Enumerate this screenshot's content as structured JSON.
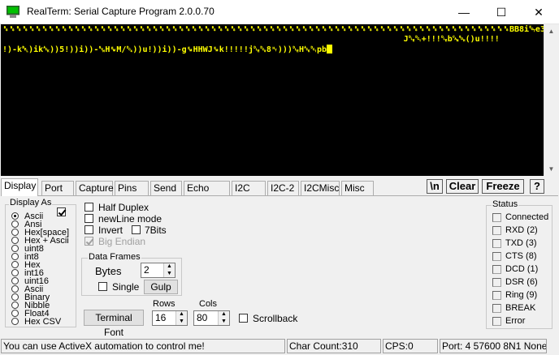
{
  "window": {
    "title": "RealTerm: Serial Capture Program 2.0.0.70",
    "minimize_glyph": "—",
    "maximize_glyph": "☐",
    "close_glyph": "✕",
    "icon": "terminal-app-icon"
  },
  "terminal": {
    "lines": [
      "␈␈␈␈␈␈␈␈␈␈␈␈␈␈␈␈␈␈␈␈␈␈␈␈␈␈␈␈␈␈␈␈␈␈␈␈␈␈␈␈␈␈␈␈␈␈␈␈␈␈␈␈␈␈␈␈␈␈␈␈␈␈␈␈␈␈␈␈␈␈␈␈␈␈␈␈␈␈BB8i␄e3J␙␁",
      "                                                                                  J␐␑+!!!␐b␘␁()u!!!!",
      "!)-k␇)ik␆))5!))i))-␖H␙M/␔))u!))i))-g␙HHWJ␙k!!!!!j␐␓8␉)))␐H␆␑pb"
    ],
    "colors": {
      "foreground": "#ffff00",
      "background": "#000000"
    }
  },
  "scrollbar": {
    "up_glyph": "▲",
    "down_glyph": "▼"
  },
  "tabs": [
    {
      "label": "Display",
      "active": true
    },
    {
      "label": "Port"
    },
    {
      "label": "Capture"
    },
    {
      "label": "Pins"
    },
    {
      "label": "Send"
    },
    {
      "label": "Echo Port"
    },
    {
      "label": "I2C"
    },
    {
      "label": "I2C-2"
    },
    {
      "label": "I2CMisc"
    },
    {
      "label": "Misc"
    }
  ],
  "toolbar": {
    "newline_label": "\\n",
    "clear_label": "Clear",
    "freeze_label": "Freeze",
    "help_label": "?"
  },
  "display_as": {
    "title": "Display As",
    "options": [
      "Ascii",
      "Ansi",
      "Hex[space]",
      "Hex + Ascii",
      "uint8",
      "int8",
      "Hex",
      "int16",
      "uint16",
      "Ascii",
      "Binary",
      "Nibble",
      "Float4",
      "Hex CSV"
    ],
    "selected": "Ascii",
    "checkbox_checked": true
  },
  "options": {
    "half_duplex": "Half Duplex",
    "newline_mode": "newLine mode",
    "invert": "Invert",
    "seven_bits": "7Bits",
    "big_endian": "Big Endian"
  },
  "data_frames": {
    "title": "Data Frames",
    "bytes_label": "Bytes",
    "bytes_value": "2",
    "single_label": "Single",
    "gulp_label": "Gulp"
  },
  "terminal_settings": {
    "terminal_font_label": "Terminal Font",
    "rows_label": "Rows",
    "rows_value": "16",
    "cols_label": "Cols",
    "cols_value": "80",
    "scrollback_label": "Scrollback"
  },
  "status_group": {
    "title": "Status",
    "items": [
      "Connected",
      "RXD (2)",
      "TXD (3)",
      "CTS (8)",
      "DCD (1)",
      "DSR (6)",
      "Ring (9)",
      "BREAK",
      "Error"
    ]
  },
  "statusbar": {
    "message": "You can use ActiveX automation to control me!",
    "char_count": "Char Count:310",
    "cps": "CPS:0",
    "port": "Port: 4 57600 8N1 None"
  }
}
